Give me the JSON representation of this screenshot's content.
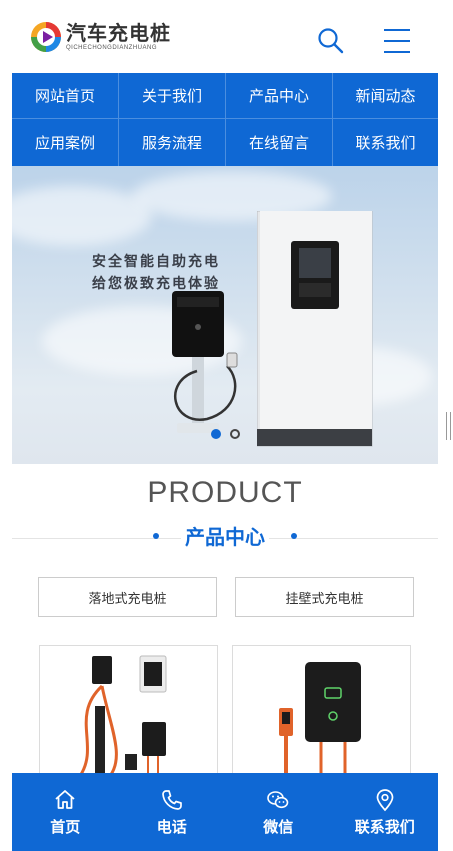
{
  "header": {
    "logo_cn": "汽车充电桩",
    "logo_en": "QICHECHONGDIANZHUANG",
    "search_icon": "search-icon",
    "menu_icon": "hamburger-menu-icon"
  },
  "nav": {
    "items": [
      {
        "label": "网站首页"
      },
      {
        "label": "关于我们"
      },
      {
        "label": "产品中心"
      },
      {
        "label": "新闻动态"
      },
      {
        "label": "应用案例"
      },
      {
        "label": "服务流程"
      },
      {
        "label": "在线留言"
      },
      {
        "label": "联系我们"
      }
    ]
  },
  "banner": {
    "line1": "安全智能自助充电",
    "line2": "给您极致充电体验",
    "active_slide": 1,
    "slide_count": 2
  },
  "product": {
    "title": "PRODUCT",
    "subtitle": "产品中心",
    "categories": [
      {
        "label": "落地式充电桩"
      },
      {
        "label": "挂壁式充电桩"
      }
    ]
  },
  "bottom_bar": {
    "items": [
      {
        "label": "首页",
        "icon": "home-icon"
      },
      {
        "label": "电话",
        "icon": "phone-icon"
      },
      {
        "label": "微信",
        "icon": "wechat-icon"
      },
      {
        "label": "联系我们",
        "icon": "location-icon"
      }
    ]
  },
  "colors": {
    "primary": "#0f68d4",
    "nav_text": "#ffffff",
    "title_gray": "#555555"
  }
}
